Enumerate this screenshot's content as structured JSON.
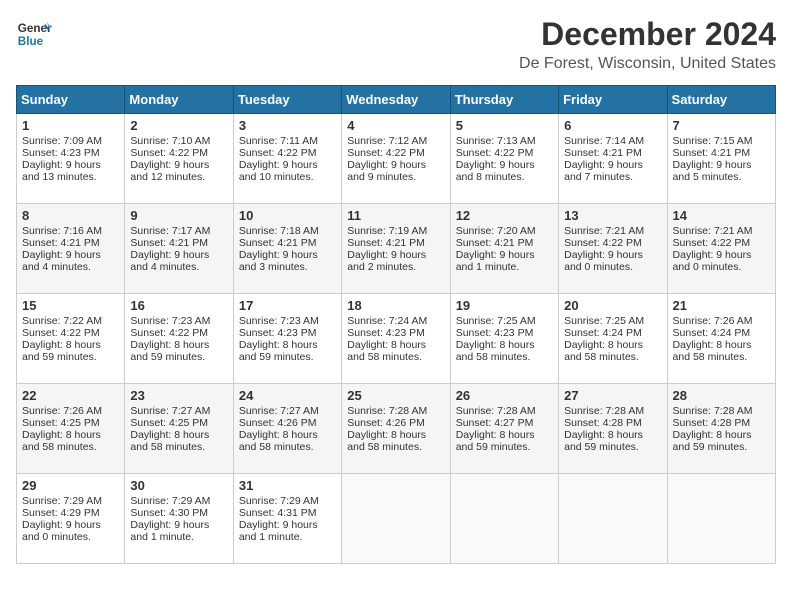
{
  "header": {
    "logo_line1": "General",
    "logo_line2": "Blue",
    "title": "December 2024",
    "subtitle": "De Forest, Wisconsin, United States"
  },
  "days_of_week": [
    "Sunday",
    "Monday",
    "Tuesday",
    "Wednesday",
    "Thursday",
    "Friday",
    "Saturday"
  ],
  "weeks": [
    [
      {
        "day": 1,
        "lines": [
          "Sunrise: 7:09 AM",
          "Sunset: 4:23 PM",
          "Daylight: 9 hours",
          "and 13 minutes."
        ]
      },
      {
        "day": 2,
        "lines": [
          "Sunrise: 7:10 AM",
          "Sunset: 4:22 PM",
          "Daylight: 9 hours",
          "and 12 minutes."
        ]
      },
      {
        "day": 3,
        "lines": [
          "Sunrise: 7:11 AM",
          "Sunset: 4:22 PM",
          "Daylight: 9 hours",
          "and 10 minutes."
        ]
      },
      {
        "day": 4,
        "lines": [
          "Sunrise: 7:12 AM",
          "Sunset: 4:22 PM",
          "Daylight: 9 hours",
          "and 9 minutes."
        ]
      },
      {
        "day": 5,
        "lines": [
          "Sunrise: 7:13 AM",
          "Sunset: 4:22 PM",
          "Daylight: 9 hours",
          "and 8 minutes."
        ]
      },
      {
        "day": 6,
        "lines": [
          "Sunrise: 7:14 AM",
          "Sunset: 4:21 PM",
          "Daylight: 9 hours",
          "and 7 minutes."
        ]
      },
      {
        "day": 7,
        "lines": [
          "Sunrise: 7:15 AM",
          "Sunset: 4:21 PM",
          "Daylight: 9 hours",
          "and 5 minutes."
        ]
      }
    ],
    [
      {
        "day": 8,
        "lines": [
          "Sunrise: 7:16 AM",
          "Sunset: 4:21 PM",
          "Daylight: 9 hours",
          "and 4 minutes."
        ]
      },
      {
        "day": 9,
        "lines": [
          "Sunrise: 7:17 AM",
          "Sunset: 4:21 PM",
          "Daylight: 9 hours",
          "and 4 minutes."
        ]
      },
      {
        "day": 10,
        "lines": [
          "Sunrise: 7:18 AM",
          "Sunset: 4:21 PM",
          "Daylight: 9 hours",
          "and 3 minutes."
        ]
      },
      {
        "day": 11,
        "lines": [
          "Sunrise: 7:19 AM",
          "Sunset: 4:21 PM",
          "Daylight: 9 hours",
          "and 2 minutes."
        ]
      },
      {
        "day": 12,
        "lines": [
          "Sunrise: 7:20 AM",
          "Sunset: 4:21 PM",
          "Daylight: 9 hours",
          "and 1 minute."
        ]
      },
      {
        "day": 13,
        "lines": [
          "Sunrise: 7:21 AM",
          "Sunset: 4:22 PM",
          "Daylight: 9 hours",
          "and 0 minutes."
        ]
      },
      {
        "day": 14,
        "lines": [
          "Sunrise: 7:21 AM",
          "Sunset: 4:22 PM",
          "Daylight: 9 hours",
          "and 0 minutes."
        ]
      }
    ],
    [
      {
        "day": 15,
        "lines": [
          "Sunrise: 7:22 AM",
          "Sunset: 4:22 PM",
          "Daylight: 8 hours",
          "and 59 minutes."
        ]
      },
      {
        "day": 16,
        "lines": [
          "Sunrise: 7:23 AM",
          "Sunset: 4:22 PM",
          "Daylight: 8 hours",
          "and 59 minutes."
        ]
      },
      {
        "day": 17,
        "lines": [
          "Sunrise: 7:23 AM",
          "Sunset: 4:23 PM",
          "Daylight: 8 hours",
          "and 59 minutes."
        ]
      },
      {
        "day": 18,
        "lines": [
          "Sunrise: 7:24 AM",
          "Sunset: 4:23 PM",
          "Daylight: 8 hours",
          "and 58 minutes."
        ]
      },
      {
        "day": 19,
        "lines": [
          "Sunrise: 7:25 AM",
          "Sunset: 4:23 PM",
          "Daylight: 8 hours",
          "and 58 minutes."
        ]
      },
      {
        "day": 20,
        "lines": [
          "Sunrise: 7:25 AM",
          "Sunset: 4:24 PM",
          "Daylight: 8 hours",
          "and 58 minutes."
        ]
      },
      {
        "day": 21,
        "lines": [
          "Sunrise: 7:26 AM",
          "Sunset: 4:24 PM",
          "Daylight: 8 hours",
          "and 58 minutes."
        ]
      }
    ],
    [
      {
        "day": 22,
        "lines": [
          "Sunrise: 7:26 AM",
          "Sunset: 4:25 PM",
          "Daylight: 8 hours",
          "and 58 minutes."
        ]
      },
      {
        "day": 23,
        "lines": [
          "Sunrise: 7:27 AM",
          "Sunset: 4:25 PM",
          "Daylight: 8 hours",
          "and 58 minutes."
        ]
      },
      {
        "day": 24,
        "lines": [
          "Sunrise: 7:27 AM",
          "Sunset: 4:26 PM",
          "Daylight: 8 hours",
          "and 58 minutes."
        ]
      },
      {
        "day": 25,
        "lines": [
          "Sunrise: 7:28 AM",
          "Sunset: 4:26 PM",
          "Daylight: 8 hours",
          "and 58 minutes."
        ]
      },
      {
        "day": 26,
        "lines": [
          "Sunrise: 7:28 AM",
          "Sunset: 4:27 PM",
          "Daylight: 8 hours",
          "and 59 minutes."
        ]
      },
      {
        "day": 27,
        "lines": [
          "Sunrise: 7:28 AM",
          "Sunset: 4:28 PM",
          "Daylight: 8 hours",
          "and 59 minutes."
        ]
      },
      {
        "day": 28,
        "lines": [
          "Sunrise: 7:28 AM",
          "Sunset: 4:28 PM",
          "Daylight: 8 hours",
          "and 59 minutes."
        ]
      }
    ],
    [
      {
        "day": 29,
        "lines": [
          "Sunrise: 7:29 AM",
          "Sunset: 4:29 PM",
          "Daylight: 9 hours",
          "and 0 minutes."
        ]
      },
      {
        "day": 30,
        "lines": [
          "Sunrise: 7:29 AM",
          "Sunset: 4:30 PM",
          "Daylight: 9 hours",
          "and 1 minute."
        ]
      },
      {
        "day": 31,
        "lines": [
          "Sunrise: 7:29 AM",
          "Sunset: 4:31 PM",
          "Daylight: 9 hours",
          "and 1 minute."
        ]
      },
      null,
      null,
      null,
      null
    ]
  ]
}
